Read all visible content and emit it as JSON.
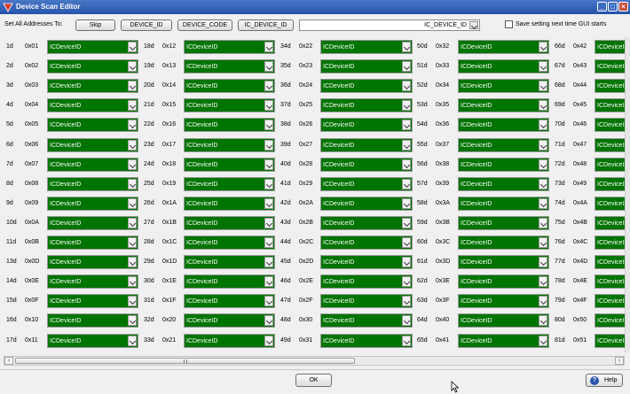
{
  "window": {
    "title": "Device Scan Editor"
  },
  "toolbar": {
    "set_all_label": "Set All Addresses To:",
    "skip_label": "Skip",
    "device_id_label": "DEVICE_ID",
    "device_code_label": "DEVICE_CODE",
    "ic_device_id_label": "IC_DEVICE_ID",
    "selected_value": "IC_DEVICE_ID",
    "save_setting_label": "Save setting next time GUI starts",
    "save_setting_checked": false
  },
  "columns": [
    {
      "rows": [
        {
          "dec": "1d",
          "hex": "0x01",
          "value": "ICDeviceID"
        },
        {
          "dec": "2d",
          "hex": "0x02",
          "value": "ICDeviceID"
        },
        {
          "dec": "3d",
          "hex": "0x03",
          "value": "ICDeviceID"
        },
        {
          "dec": "4d",
          "hex": "0x04",
          "value": "ICDeviceID"
        },
        {
          "dec": "5d",
          "hex": "0x05",
          "value": "ICDeviceID"
        },
        {
          "dec": "6d",
          "hex": "0x06",
          "value": "ICDeviceID"
        },
        {
          "dec": "7d",
          "hex": "0x07",
          "value": "ICDeviceID"
        },
        {
          "dec": "8d",
          "hex": "0x08",
          "value": "ICDeviceID"
        },
        {
          "dec": "9d",
          "hex": "0x09",
          "value": "ICDeviceID"
        },
        {
          "dec": "10d",
          "hex": "0x0A",
          "value": "ICDeviceID"
        },
        {
          "dec": "11d",
          "hex": "0x0B",
          "value": "ICDeviceID"
        },
        {
          "dec": "13d",
          "hex": "0x0D",
          "value": "ICDeviceID"
        },
        {
          "dec": "14d",
          "hex": "0x0E",
          "value": "ICDeviceID"
        },
        {
          "dec": "15d",
          "hex": "0x0F",
          "value": "ICDeviceID"
        },
        {
          "dec": "16d",
          "hex": "0x10",
          "value": "ICDeviceID"
        },
        {
          "dec": "17d",
          "hex": "0x11",
          "value": "ICDeviceID"
        }
      ]
    },
    {
      "rows": [
        {
          "dec": "18d",
          "hex": "0x12",
          "value": "ICDeviceID"
        },
        {
          "dec": "19d",
          "hex": "0x13",
          "value": "ICDeviceID"
        },
        {
          "dec": "20d",
          "hex": "0x14",
          "value": "ICDeviceID"
        },
        {
          "dec": "21d",
          "hex": "0x15",
          "value": "ICDeviceID"
        },
        {
          "dec": "22d",
          "hex": "0x16",
          "value": "ICDeviceID"
        },
        {
          "dec": "23d",
          "hex": "0x17",
          "value": "ICDeviceID"
        },
        {
          "dec": "24d",
          "hex": "0x18",
          "value": "ICDeviceID"
        },
        {
          "dec": "25d",
          "hex": "0x19",
          "value": "ICDeviceID"
        },
        {
          "dec": "26d",
          "hex": "0x1A",
          "value": "ICDeviceID"
        },
        {
          "dec": "27d",
          "hex": "0x1B",
          "value": "ICDeviceID"
        },
        {
          "dec": "28d",
          "hex": "0x1C",
          "value": "ICDeviceID"
        },
        {
          "dec": "29d",
          "hex": "0x1D",
          "value": "ICDeviceID"
        },
        {
          "dec": "30d",
          "hex": "0x1E",
          "value": "ICDeviceID"
        },
        {
          "dec": "31d",
          "hex": "0x1F",
          "value": "ICDeviceID"
        },
        {
          "dec": "32d",
          "hex": "0x20",
          "value": "ICDeviceID"
        },
        {
          "dec": "33d",
          "hex": "0x21",
          "value": "ICDeviceID"
        }
      ]
    },
    {
      "rows": [
        {
          "dec": "34d",
          "hex": "0x22",
          "value": "ICDeviceID"
        },
        {
          "dec": "35d",
          "hex": "0x23",
          "value": "ICDeviceID"
        },
        {
          "dec": "36d",
          "hex": "0x24",
          "value": "ICDeviceID"
        },
        {
          "dec": "37d",
          "hex": "0x25",
          "value": "ICDeviceID"
        },
        {
          "dec": "38d",
          "hex": "0x26",
          "value": "ICDeviceID"
        },
        {
          "dec": "39d",
          "hex": "0x27",
          "value": "ICDeviceID"
        },
        {
          "dec": "40d",
          "hex": "0x28",
          "value": "ICDeviceID"
        },
        {
          "dec": "41d",
          "hex": "0x29",
          "value": "ICDeviceID"
        },
        {
          "dec": "42d",
          "hex": "0x2A",
          "value": "ICDeviceID"
        },
        {
          "dec": "43d",
          "hex": "0x2B",
          "value": "ICDeviceID"
        },
        {
          "dec": "44d",
          "hex": "0x2C",
          "value": "ICDeviceID"
        },
        {
          "dec": "45d",
          "hex": "0x2D",
          "value": "ICDeviceID"
        },
        {
          "dec": "46d",
          "hex": "0x2E",
          "value": "ICDeviceID"
        },
        {
          "dec": "47d",
          "hex": "0x2F",
          "value": "ICDeviceID"
        },
        {
          "dec": "48d",
          "hex": "0x30",
          "value": "ICDeviceID"
        },
        {
          "dec": "49d",
          "hex": "0x31",
          "value": "ICDeviceID"
        }
      ]
    },
    {
      "rows": [
        {
          "dec": "50d",
          "hex": "0x32",
          "value": "ICDeviceID"
        },
        {
          "dec": "51d",
          "hex": "0x33",
          "value": "ICDeviceID"
        },
        {
          "dec": "52d",
          "hex": "0x34",
          "value": "ICDeviceID"
        },
        {
          "dec": "53d",
          "hex": "0x35",
          "value": "ICDeviceID"
        },
        {
          "dec": "54d",
          "hex": "0x36",
          "value": "ICDeviceID"
        },
        {
          "dec": "55d",
          "hex": "0x37",
          "value": "ICDeviceID"
        },
        {
          "dec": "56d",
          "hex": "0x38",
          "value": "ICDeviceID"
        },
        {
          "dec": "57d",
          "hex": "0x39",
          "value": "ICDeviceID"
        },
        {
          "dec": "58d",
          "hex": "0x3A",
          "value": "ICDeviceID"
        },
        {
          "dec": "59d",
          "hex": "0x3B",
          "value": "ICDeviceID"
        },
        {
          "dec": "60d",
          "hex": "0x3C",
          "value": "ICDeviceID"
        },
        {
          "dec": "61d",
          "hex": "0x3D",
          "value": "ICDeviceID"
        },
        {
          "dec": "62d",
          "hex": "0x3E",
          "value": "ICDeviceID"
        },
        {
          "dec": "63d",
          "hex": "0x3F",
          "value": "ICDeviceID"
        },
        {
          "dec": "64d",
          "hex": "0x40",
          "value": "ICDeviceID"
        },
        {
          "dec": "65d",
          "hex": "0x41",
          "value": "ICDeviceID"
        }
      ]
    },
    {
      "rows": [
        {
          "dec": "66d",
          "hex": "0x42",
          "value": "ICDeviceID"
        },
        {
          "dec": "67d",
          "hex": "0x43",
          "value": "ICDeviceID"
        },
        {
          "dec": "68d",
          "hex": "0x44",
          "value": "ICDeviceID"
        },
        {
          "dec": "69d",
          "hex": "0x45",
          "value": "ICDeviceID"
        },
        {
          "dec": "70d",
          "hex": "0x46",
          "value": "ICDeviceID"
        },
        {
          "dec": "71d",
          "hex": "0x47",
          "value": "ICDeviceID"
        },
        {
          "dec": "72d",
          "hex": "0x48",
          "value": "ICDeviceID"
        },
        {
          "dec": "73d",
          "hex": "0x49",
          "value": "ICDeviceID"
        },
        {
          "dec": "74d",
          "hex": "0x4A",
          "value": "ICDeviceID"
        },
        {
          "dec": "75d",
          "hex": "0x4B",
          "value": "ICDeviceID"
        },
        {
          "dec": "76d",
          "hex": "0x4C",
          "value": "ICDeviceID"
        },
        {
          "dec": "77d",
          "hex": "0x4D",
          "value": "ICDeviceID"
        },
        {
          "dec": "78d",
          "hex": "0x4E",
          "value": "ICDeviceID"
        },
        {
          "dec": "79d",
          "hex": "0x4F",
          "value": "ICDeviceID"
        },
        {
          "dec": "80d",
          "hex": "0x50",
          "value": "ICDeviceID"
        },
        {
          "dec": "81d",
          "hex": "0x51",
          "value": "ICDeviceID"
        }
      ]
    }
  ],
  "colors": {
    "cell_green": "#007400",
    "title_blue": "#2553a8"
  },
  "footer": {
    "ok_label": "OK",
    "help_label": "Help"
  }
}
